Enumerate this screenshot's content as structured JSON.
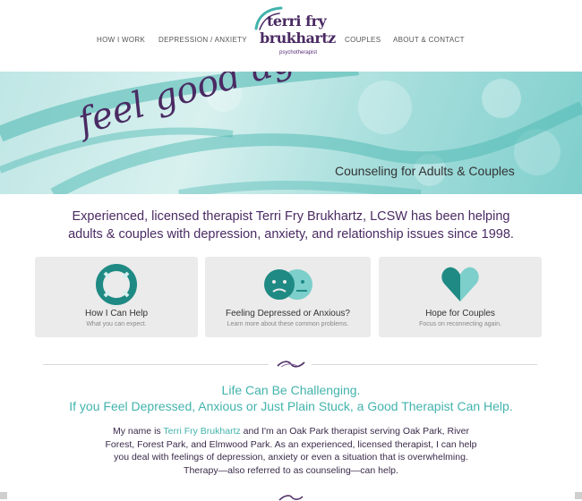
{
  "nav": {
    "items": [
      "HOW I WORK",
      "DEPRESSION / ANXIETY",
      "COUPLES",
      "ABOUT & CONTACT"
    ]
  },
  "logo": {
    "line1": "terri fry",
    "line2": "brukhartz",
    "tagline": "psychotherapist"
  },
  "hero": {
    "script": "feel good again",
    "subtitle": "Counseling for Adults & Couples"
  },
  "intro": {
    "line1": "Experienced, licensed therapist Terri Fry Brukhartz, LCSW has been helping",
    "line2": "adults & couples with depression, anxiety, and relationship issues since 1998."
  },
  "cards": [
    {
      "title": "How I Can Help",
      "desc": "What you can expect.",
      "icon": "life-ring-icon"
    },
    {
      "title": "Feeling Depressed or Anxious?",
      "desc": "Learn more about these common problems.",
      "icon": "sad-faces-icon"
    },
    {
      "title": "Hope for Couples",
      "desc": "Focus on reconnecting again.",
      "icon": "heart-icon"
    }
  ],
  "section": {
    "heading1": "Life Can Be Challenging.",
    "heading2": "If you Feel Depressed, Anxious or Just Plain Stuck, a Good Therapist Can Help."
  },
  "body": {
    "pre_link": "My name is ",
    "link": "Terri Fry Brukhartz",
    "post_link": " and I'm an Oak Park therapist serving Oak Park, River",
    "line2": "Forest, Forest Park, and Elmwood Park. As an experienced, licensed therapist, I can help",
    "line3": "you deal with feelings of depression, anxiety or even a situation that is overwhelming.",
    "line4": "Therapy—also referred to as counseling—can help."
  },
  "colors": {
    "purple": "#4a2a63",
    "teal": "#43b3ad",
    "card_bg": "#ebebeb"
  }
}
